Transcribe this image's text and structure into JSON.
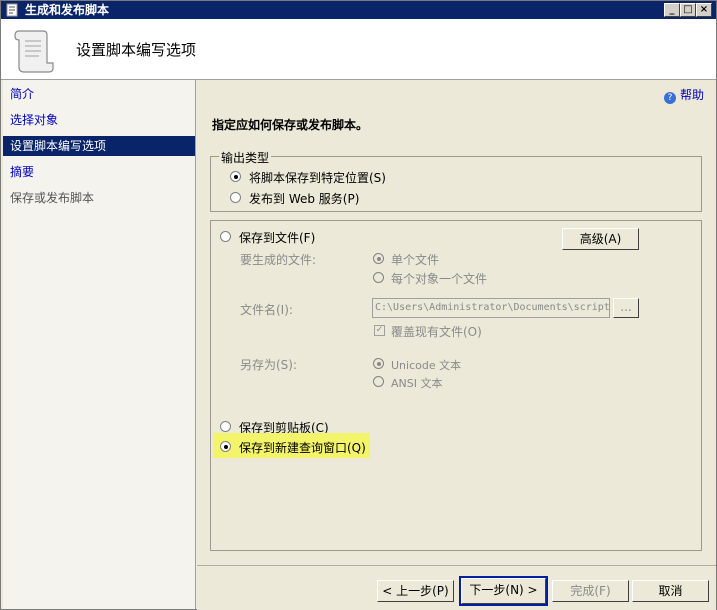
{
  "window": {
    "title": "生成和发布脚本",
    "min_label": "_",
    "max_label": "□",
    "close_label": "×"
  },
  "header": {
    "title": "设置脚本编写选项"
  },
  "sidebar": {
    "items": [
      {
        "label": "简介"
      },
      {
        "label": "选择对象"
      },
      {
        "label": "设置脚本编写选项"
      },
      {
        "label": "摘要"
      },
      {
        "label": "保存或发布脚本"
      }
    ]
  },
  "main": {
    "help_label": "帮助",
    "instruction": "指定应如何保存或发布脚本。",
    "output_type": {
      "legend": "输出类型",
      "options": [
        "将脚本保存到特定位置(S)",
        "发布到 Web 服务(P)"
      ],
      "selected": 0
    },
    "save_to_file": {
      "label": "保存到文件(F)",
      "advanced_button": "高级(A)",
      "files_label": "要生成的文件:",
      "file_options": [
        "单个文件",
        "每个对象一个文件"
      ],
      "filename_label": "文件名(I):",
      "filename_value": "C:\\Users\\Administrator\\Documents\\script",
      "browse_label": "...",
      "overwrite_label": "覆盖现有文件(O)",
      "save_as_label": "另存为(S):",
      "encoding_options": [
        "Unicode 文本",
        "ANSI 文本"
      ]
    },
    "clipboard_label": "保存到剪贴板(C)",
    "new_query_label": "保存到新建查询窗口(Q)"
  },
  "footer": {
    "back": "< 上一步(P)",
    "next": "下一步(N) >",
    "finish": "完成(F)",
    "cancel": "取消"
  }
}
